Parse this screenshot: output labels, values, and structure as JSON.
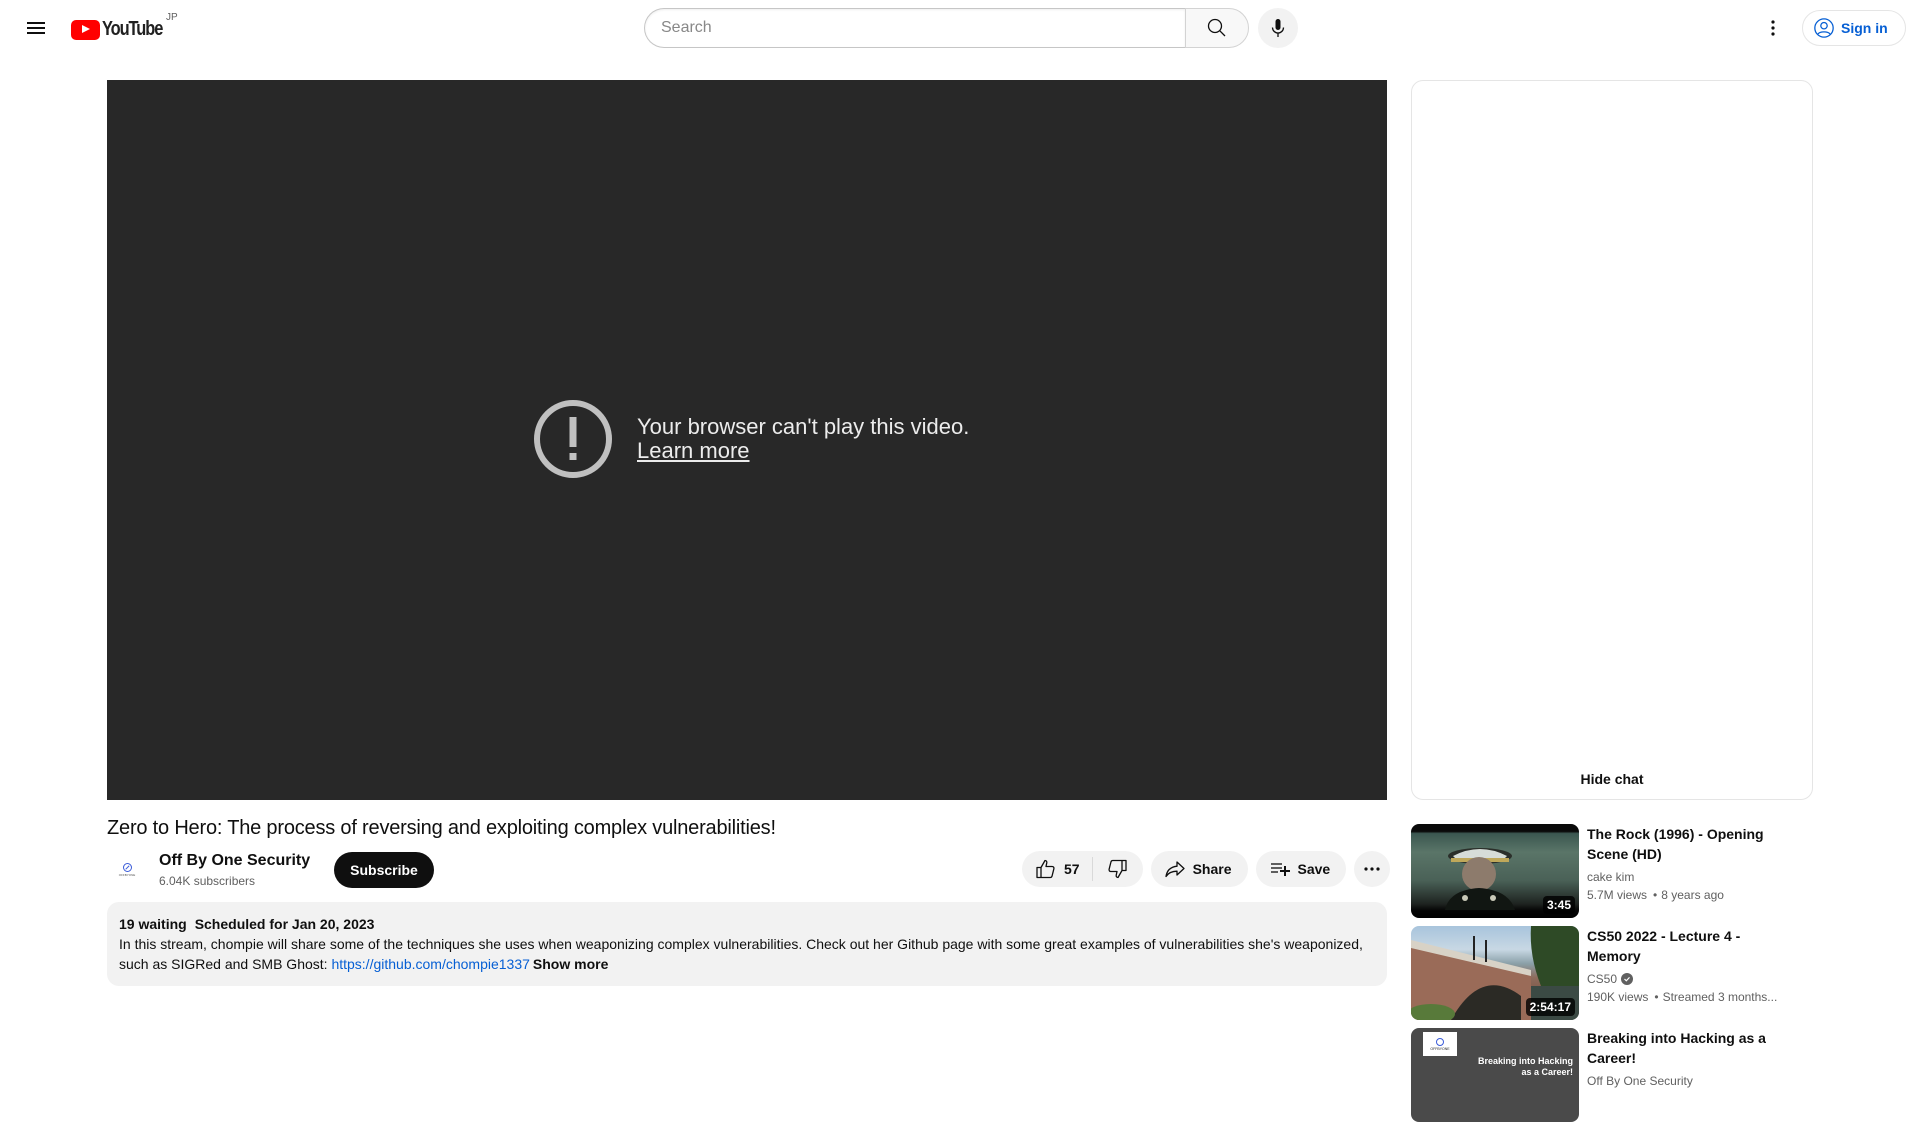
{
  "masthead": {
    "logo_text": "YouTube",
    "country_code": "JP",
    "search_placeholder": "Search",
    "search_value": "",
    "sign_in_label": "Sign in",
    "brand_color": "#ff0000",
    "link_color": "#065fd4"
  },
  "player": {
    "error_message": "Your browser can't play this video.",
    "learn_more_label": "Learn more"
  },
  "video": {
    "title": "Zero to Hero: The process of reversing and exploiting complex vulnerabilities!",
    "channel_name": "Off By One Security",
    "channel_avatar_text": "OFFBYONE",
    "subscribers": "6.04K subscribers",
    "subscribe_label": "Subscribe",
    "like_count": "57",
    "share_label": "Share",
    "save_label": "Save"
  },
  "description": {
    "waiting": "19 waiting",
    "scheduled": "Scheduled for Jan 20, 2023",
    "text_before_link": "In this stream, chompie will share some of the techniques she uses when weaponizing complex vulnerabilities. Check out her Github page with some great examples of vulnerabilities she's weaponized, such as SIGRed and SMB Ghost: ",
    "link": "https://github.com/chompie1337",
    "show_more_label": "Show more"
  },
  "chat": {
    "hide_chat_label": "Hide chat"
  },
  "recommendations": [
    {
      "title": "The Rock (1996) - Opening Scene (HD)",
      "channel": "cake kim",
      "verified": false,
      "views": "5.7M views",
      "age": "8 years ago",
      "duration": "3:45"
    },
    {
      "title": "CS50 2022 - Lecture 4 - Memory",
      "channel": "CS50",
      "verified": true,
      "views": "190K views",
      "age": "Streamed 3 months...",
      "duration": "2:54:17"
    },
    {
      "title": "Breaking into Hacking as a Career!",
      "channel": "Off By One Security",
      "verified": false,
      "views": "",
      "age": "",
      "duration": "",
      "thumb_text": "Breaking into Hacking as a Career!",
      "thumb_logo_text": "OFFBYONE"
    }
  ]
}
